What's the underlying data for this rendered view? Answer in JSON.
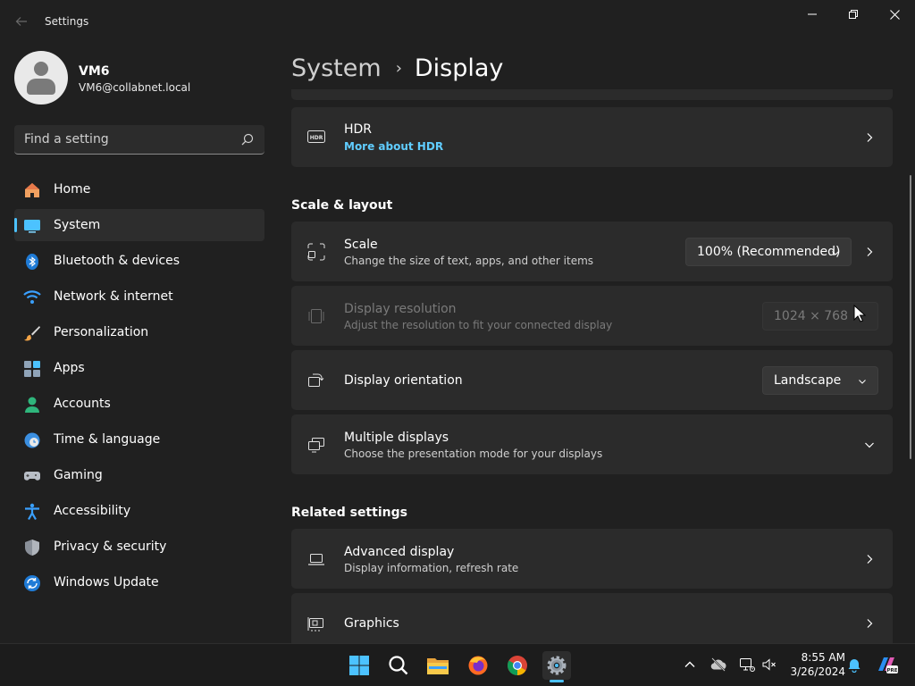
{
  "window": {
    "app_title": "Settings",
    "back_icon": "arrow-left-icon",
    "controls": [
      "minimize-icon",
      "maximize-icon",
      "close-icon"
    ]
  },
  "profile": {
    "name": "VM6",
    "email": "VM6@collabnet.local"
  },
  "search": {
    "placeholder": "Find a setting",
    "icon": "search-icon"
  },
  "sidebar": {
    "items": [
      {
        "label": "Home",
        "icon": "home-icon"
      },
      {
        "label": "System",
        "icon": "monitor-icon",
        "active": true
      },
      {
        "label": "Bluetooth & devices",
        "icon": "bluetooth-icon"
      },
      {
        "label": "Network & internet",
        "icon": "wifi-icon"
      },
      {
        "label": "Personalization",
        "icon": "brush-icon"
      },
      {
        "label": "Apps",
        "icon": "apps-icon"
      },
      {
        "label": "Accounts",
        "icon": "person-icon"
      },
      {
        "label": "Time & language",
        "icon": "clock-globe-icon"
      },
      {
        "label": "Gaming",
        "icon": "gamepad-icon"
      },
      {
        "label": "Accessibility",
        "icon": "accessibility-icon"
      },
      {
        "label": "Privacy & security",
        "icon": "shield-icon"
      },
      {
        "label": "Windows Update",
        "icon": "update-icon"
      }
    ]
  },
  "breadcrumb": {
    "parent": "System",
    "separator": "›",
    "current": "Display"
  },
  "main": {
    "hdr": {
      "title": "HDR",
      "link": "More about HDR",
      "icon": "hdr-icon"
    },
    "section_scale": "Scale & layout",
    "scale": {
      "title": "Scale",
      "subtitle": "Change the size of text, apps, and other items",
      "value": "100% (Recommended)",
      "icon": "scale-icon"
    },
    "resolution": {
      "title": "Display resolution",
      "subtitle": "Adjust the resolution to fit your connected display",
      "value": "1024 × 768",
      "icon": "resolution-icon",
      "disabled": true
    },
    "orientation": {
      "title": "Display orientation",
      "value": "Landscape",
      "icon": "orientation-icon"
    },
    "multiple": {
      "title": "Multiple displays",
      "subtitle": "Choose the presentation mode for your displays",
      "icon": "multiple-displays-icon"
    },
    "section_related": "Related settings",
    "advanced": {
      "title": "Advanced display",
      "subtitle": "Display information, refresh rate",
      "icon": "laptop-icon"
    },
    "graphics": {
      "title": "Graphics",
      "icon": "graphics-card-icon"
    }
  },
  "taskbar": {
    "apps": [
      "windows-start-icon",
      "search-icon",
      "file-explorer-icon",
      "firefox-icon",
      "chrome-icon",
      "settings-gear-icon"
    ],
    "tray": [
      "chevron-up-icon",
      "cloud-offline-icon",
      "network-icon",
      "volume-muted-icon",
      "notification-bell-icon",
      "copilot-icon"
    ],
    "time": "8:55 AM",
    "date": "3/26/2024"
  },
  "colors": {
    "accent": "#4cc2ff",
    "link": "#60cdff",
    "background": "#202020",
    "card": "#2b2b2b"
  }
}
